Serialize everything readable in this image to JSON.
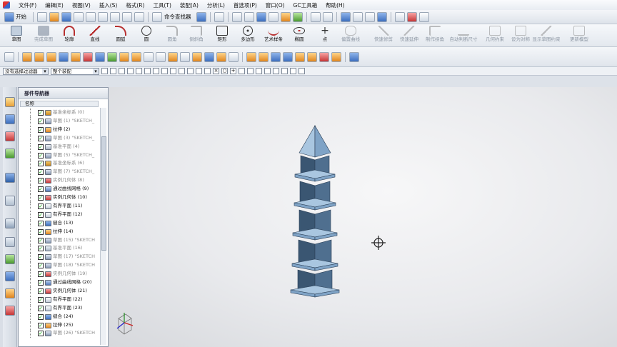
{
  "menubar": {
    "items": [
      "文件(F)",
      "编辑(E)",
      "视图(V)",
      "插入(S)",
      "格式(R)",
      "工具(T)",
      "装配(A)",
      "分析(L)",
      "首选项(P)",
      "窗口(O)",
      "GC工具箱",
      "帮助(H)"
    ]
  },
  "toolbar1": {
    "start_label": "开始",
    "command_finder_label": "命令查找器"
  },
  "toolbar2": {
    "tools": [
      {
        "label": "草图",
        "icon": "sketch-icon",
        "enabled": true
      },
      {
        "label": "完成草图",
        "icon": "finish-sketch-icon",
        "enabled": false
      },
      {
        "label": "轮廓",
        "icon": "profile-icon",
        "enabled": true
      },
      {
        "label": "直线",
        "icon": "line-icon",
        "enabled": true
      },
      {
        "label": "圆弧",
        "icon": "arc-icon",
        "enabled": true
      },
      {
        "label": "圆",
        "icon": "circle-icon",
        "enabled": true
      },
      {
        "label": "圆角",
        "icon": "fillet-icon",
        "enabled": false
      },
      {
        "label": "倒斜角",
        "icon": "chamfer-icon",
        "enabled": false
      },
      {
        "label": "矩形",
        "icon": "rectangle-icon",
        "enabled": true
      },
      {
        "label": "多边形",
        "icon": "polygon-icon",
        "enabled": true
      },
      {
        "label": "艺术样条",
        "icon": "spline-icon",
        "enabled": true
      },
      {
        "label": "椭圆",
        "icon": "ellipse-icon",
        "enabled": true
      },
      {
        "label": "点",
        "icon": "point-icon",
        "enabled": true
      },
      {
        "label": "偏置曲线",
        "icon": "offset-curve-icon",
        "enabled": false
      },
      {
        "label": "快速修剪",
        "icon": "quick-trim-icon",
        "enabled": false
      },
      {
        "label": "快速延伸",
        "icon": "quick-extend-icon",
        "enabled": false
      },
      {
        "label": "制作拐角",
        "icon": "make-corner-icon",
        "enabled": false
      },
      {
        "label": "自动判断尺寸",
        "icon": "inferred-dimension-icon",
        "enabled": false
      },
      {
        "label": "几何约束",
        "icon": "geometric-constraint-icon",
        "enabled": false
      },
      {
        "label": "设为对称",
        "icon": "make-symmetric-icon",
        "enabled": false
      },
      {
        "label": "显示草图约束",
        "icon": "show-constraints-icon",
        "enabled": false
      },
      {
        "label": "更新模型",
        "icon": "update-model-icon",
        "enabled": false
      }
    ]
  },
  "selection_bar": {
    "filter_value": "没有选择过滤器",
    "scope_value": "整个装配"
  },
  "navigator": {
    "title": "部件导航器",
    "column_name": "名称",
    "rows": [
      {
        "text": "基准坐标系 (0)",
        "icon": "datum-csys-icon",
        "suppressed": true
      },
      {
        "text": "草图 (1) \"SKETCH_",
        "icon": "sketch-feature-icon",
        "suppressed": true
      },
      {
        "text": "拉伸 (2)",
        "icon": "extrude-icon",
        "suppressed": false
      },
      {
        "text": "草图 (3) \"SKETCH_",
        "icon": "sketch-feature-icon",
        "suppressed": true
      },
      {
        "text": "基准平面 (4)",
        "icon": "datum-plane-icon",
        "suppressed": true
      },
      {
        "text": "草图 (5) \"SKETCH_",
        "icon": "sketch-feature-icon",
        "suppressed": true
      },
      {
        "text": "基准坐标系 (6)",
        "icon": "datum-csys-icon",
        "suppressed": true
      },
      {
        "text": "草图 (7) \"SKETCH_",
        "icon": "sketch-feature-icon",
        "suppressed": true
      },
      {
        "text": "实例几何体 (8)",
        "icon": "instance-geometry-icon",
        "suppressed": true
      },
      {
        "text": "通过曲线网格 (9)",
        "icon": "curve-mesh-icon",
        "suppressed": false
      },
      {
        "text": "实例几何体 (10)",
        "icon": "instance-geometry-icon",
        "suppressed": false
      },
      {
        "text": "有界平面 (11)",
        "icon": "bounded-plane-icon",
        "suppressed": false
      },
      {
        "text": "有界平面 (12)",
        "icon": "bounded-plane-icon",
        "suppressed": false
      },
      {
        "text": "缝合 (13)",
        "icon": "sew-icon",
        "suppressed": false
      },
      {
        "text": "拉伸 (14)",
        "icon": "extrude-icon",
        "suppressed": false
      },
      {
        "text": "草图 (15) \"SKETCH",
        "icon": "sketch-feature-icon",
        "suppressed": true
      },
      {
        "text": "基准平面 (16)",
        "icon": "datum-plane-icon",
        "suppressed": true
      },
      {
        "text": "草图 (17) \"SKETCH",
        "icon": "sketch-feature-icon",
        "suppressed": true
      },
      {
        "text": "草图 (18) \"SKETCH",
        "icon": "sketch-feature-icon",
        "suppressed": true
      },
      {
        "text": "实例几何体 (19)",
        "icon": "instance-geometry-icon",
        "suppressed": true
      },
      {
        "text": "通过曲线网格 (20)",
        "icon": "curve-mesh-icon",
        "suppressed": false
      },
      {
        "text": "实例几何体 (21)",
        "icon": "instance-geometry-icon",
        "suppressed": false
      },
      {
        "text": "有界平面 (22)",
        "icon": "bounded-plane-icon",
        "suppressed": false
      },
      {
        "text": "有界平面 (23)",
        "icon": "bounded-plane-icon",
        "suppressed": false
      },
      {
        "text": "缝合 (24)",
        "icon": "sew-icon",
        "suppressed": false
      },
      {
        "text": "拉伸 (25)",
        "icon": "extrude-icon",
        "suppressed": false
      },
      {
        "text": "草图 (26) \"SKETCH",
        "icon": "sketch-feature-icon",
        "suppressed": true
      }
    ]
  },
  "colors": {
    "pagoda_front": "#4f6f8f",
    "pagoda_side": "#3a5672",
    "pagoda_eave_top": "#a9c6e0",
    "pagoda_eave_edge": "#7fa3c6",
    "check_green": "#00a000"
  }
}
